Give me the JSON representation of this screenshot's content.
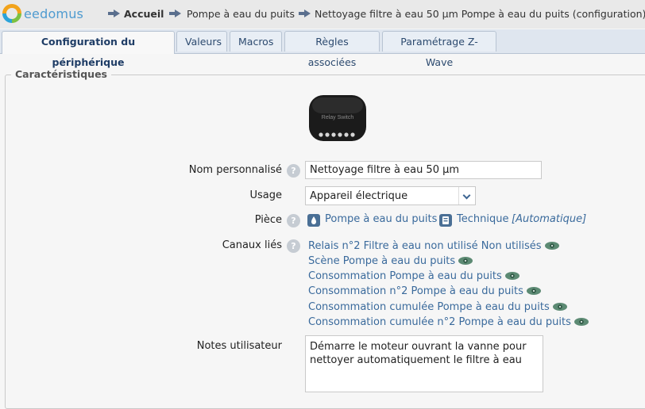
{
  "header": {
    "brand": "eedomus",
    "breadcrumbs": [
      "Accueil",
      "Pompe à eau du puits",
      "Nettoyage filtre à eau 50 µm Pompe à eau du puits (configuration)"
    ]
  },
  "tabs": [
    {
      "label": "Configuration du périphérique",
      "active": true
    },
    {
      "label": "Valeurs"
    },
    {
      "label": "Macros"
    },
    {
      "label": "Règles associées"
    },
    {
      "label": "Paramétrage Z-Wave"
    }
  ],
  "section": {
    "legend": "Caractéristiques",
    "device_image_text": "Relay Switch"
  },
  "form": {
    "name_label": "Nom personnalisé",
    "name_value": "Nettoyage filtre à eau 50 µm",
    "usage_label": "Usage",
    "usage_value": "Appareil électrique",
    "piece_label": "Pièce",
    "piece_link": "Pompe à eau du puits",
    "piece_category": "Technique",
    "piece_auto": "[Automatique]",
    "canaux_label": "Canaux liés",
    "canaux": [
      "Relais n°2 Filtre à eau non utilisé Non utilisés",
      "Scène Pompe à eau du puits",
      "Consommation Pompe à eau du puits",
      "Consommation n°2 Pompe à eau du puits",
      "Consommation cumulée Pompe à eau du puits",
      "Consommation cumulée n°2 Pompe à eau du puits"
    ],
    "notes_label": "Notes utilisateur",
    "notes_value": "Démarre le moteur ouvrant la vanne pour nettoyer automatiquement le filtre à eau",
    "help_glyph": "?"
  },
  "colors": {
    "accent": "#3a6a9c",
    "tab_active_text": "#1f3d66"
  }
}
